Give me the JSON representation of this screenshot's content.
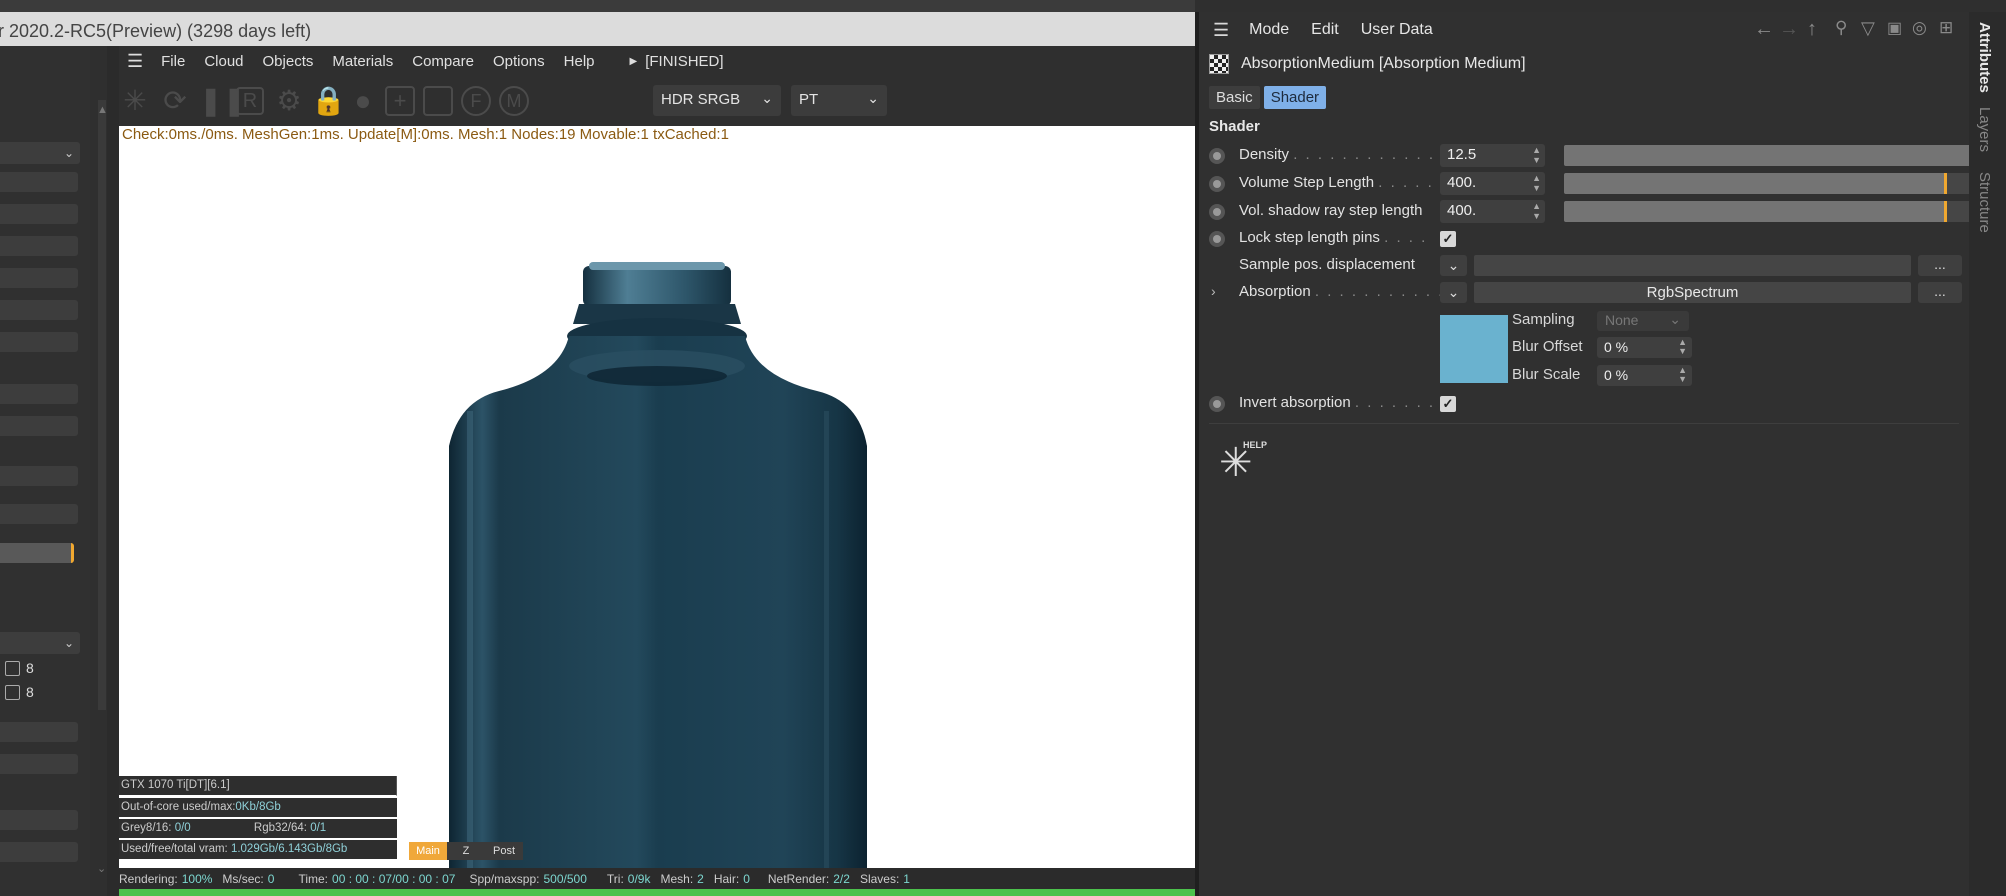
{
  "titlebar": {
    "text": "r 2020.2-RC5(Preview) (3298 days left)"
  },
  "viewport": {
    "menu": [
      "File",
      "Cloud",
      "Objects",
      "Materials",
      "Compare",
      "Options",
      "Help"
    ],
    "status_indicator": "[FINISHED]",
    "color_space": "HDR SRGB",
    "kernel": "PT",
    "status_line": "Check:0ms./0ms. MeshGen:1ms. Update[M]:0ms. Mesh:1 Nodes:19 Movable:1 txCached:1",
    "gpu": "GTX 1070 Ti[DT][6.1]",
    "out_of_core_label": "Out-of-core used/max:",
    "out_of_core_value": "0Kb/8Gb",
    "grey_label": "Grey8/16:",
    "grey_value": "0/0",
    "rgb_label": "Rgb32/64:",
    "rgb_value": "0/1",
    "vram_label": "Used/free/total vram:",
    "vram_value": "1.029Gb/6.143Gb/8Gb",
    "mode_buttons": [
      "Main",
      "Z",
      "Post"
    ],
    "bottom": {
      "rendering_label": "Rendering:",
      "rendering_value": "100%",
      "ms_label": "Ms/sec:",
      "ms_value": "0",
      "time_label": "Time:",
      "time_value": "00 : 00 : 07/00 : 00 : 07",
      "spp_label": "Spp/maxspp:",
      "spp_value": "500/500",
      "tri_label": "Tri:",
      "tri_value": "0/9k",
      "mesh_label": "Mesh:",
      "mesh_value": "2",
      "hair_label": "Hair:",
      "hair_value": "0",
      "net_label": "NetRender:",
      "net_value": "2/2",
      "slaves_label": "Slaves:",
      "slaves_value": "1"
    },
    "progress": 1.0
  },
  "left_panel": {
    "check1": "8",
    "check2": "8"
  },
  "attributes": {
    "menu": [
      "Mode",
      "Edit",
      "User Data"
    ],
    "object_title": "AbsorptionMedium [Absorption Medium]",
    "tabs": [
      {
        "label": "Basic",
        "active": false
      },
      {
        "label": "Shader",
        "active": true
      }
    ],
    "section": "Shader",
    "density": {
      "label": "Density",
      "value": "12.5",
      "fraction": 1.0
    },
    "volume_step": {
      "label": "Volume Step Length",
      "value": "400.",
      "fraction": 0.97
    },
    "shadow_step": {
      "label": "Vol. shadow ray step length",
      "value": "400.",
      "fraction": 0.97
    },
    "lock_pins": {
      "label": "Lock step length pins",
      "checked": true
    },
    "sample_disp": {
      "label": "Sample pos. displacement",
      "more": "..."
    },
    "absorption": {
      "label": "Absorption",
      "shader": "RgbSpectrum",
      "more": "..."
    },
    "sampling": {
      "label": "Sampling",
      "value": "None"
    },
    "blur_offset": {
      "label": "Blur Offset",
      "value": "0 %"
    },
    "blur_scale": {
      "label": "Blur Scale",
      "value": "0 %"
    },
    "invert": {
      "label": "Invert absorption",
      "checked": true
    },
    "swatch_color": "#6ab2cf",
    "help_label": "HELP"
  },
  "vertical_tabs": [
    "Attributes",
    "Layers",
    "Structure"
  ]
}
